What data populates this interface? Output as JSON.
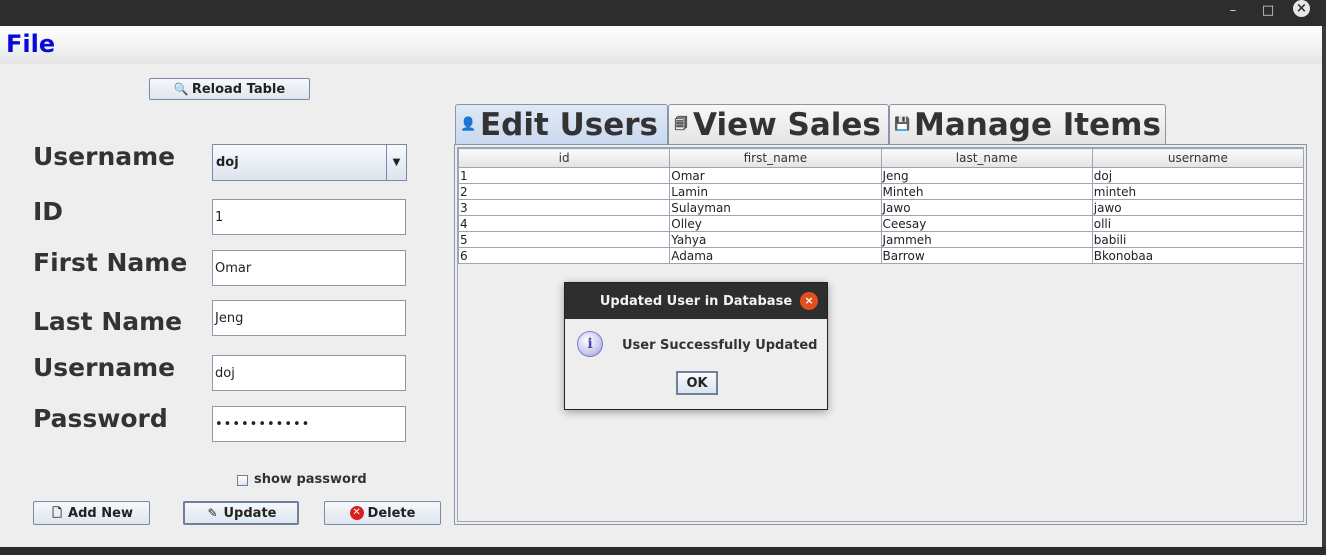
{
  "window": {
    "minimize": "–",
    "maximize": "□",
    "close": "×"
  },
  "menu": {
    "file": "File"
  },
  "toolbar": {
    "reload": "Reload Table"
  },
  "form": {
    "username_combo_label": "Username",
    "username_combo_value": "doj",
    "id_label": "ID",
    "id_value": "1",
    "first_name_label": "First Name",
    "first_name_value": "Omar",
    "last_name_label": "Last Name",
    "last_name_value": "Jeng",
    "username_label": "Username",
    "username_value": "doj",
    "password_label": "Password",
    "password_value": "•••••••••••",
    "show_password": "show password"
  },
  "actions": {
    "add_new": "Add New",
    "update": "Update",
    "delete": "Delete"
  },
  "tabs": [
    {
      "label": "Edit Users",
      "icon": "user-icon"
    },
    {
      "label": "View Sales",
      "icon": "sales-icon"
    },
    {
      "label": "Manage Items",
      "icon": "save-icon"
    }
  ],
  "table": {
    "columns": [
      "id",
      "first_name",
      "last_name",
      "username"
    ],
    "rows": [
      [
        "1",
        "Omar",
        "Jeng",
        "doj"
      ],
      [
        "2",
        "Lamin",
        "Minteh",
        "minteh"
      ],
      [
        "3",
        "Sulayman",
        "Jawo",
        "jawo"
      ],
      [
        "4",
        "Olley",
        "Ceesay",
        "olli"
      ],
      [
        "5",
        "Yahya",
        "Jammeh",
        "babili"
      ],
      [
        "6",
        "Adama",
        "Barrow",
        "Bkonobaa"
      ]
    ]
  },
  "dialog": {
    "title": "Updated User in Database",
    "message": "User Successfully Updated",
    "ok": "OK",
    "close": "×",
    "info_icon": "i"
  },
  "colors": {
    "menu_file": "#0a0ad8",
    "dialog_titlebar": "#2e2e2e",
    "dialog_close": "#e0501f"
  }
}
